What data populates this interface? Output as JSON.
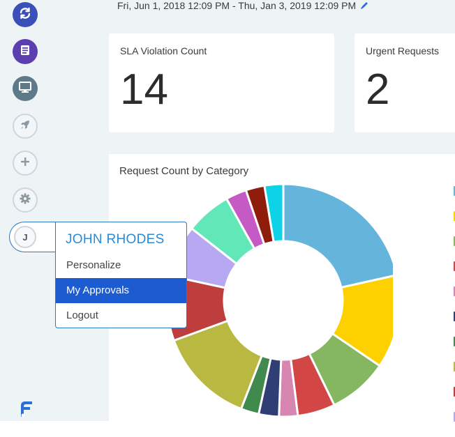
{
  "header": {
    "date_range": "Fri, Jun 1, 2018 12:09 PM - Thu, Jan 3, 2019 12:09 PM",
    "edit_icon": "pencil-icon"
  },
  "sidebar": {
    "items": [
      {
        "icon": "refresh-icon",
        "color": "#3b4fb8"
      },
      {
        "icon": "book-icon",
        "color": "#5b3fae"
      },
      {
        "icon": "monitor-icon",
        "color": "#5e7a89"
      },
      {
        "icon": "rocket-icon"
      },
      {
        "icon": "plus-icon"
      },
      {
        "icon": "gear-icon"
      }
    ],
    "logo_icon": "brand-logo-icon"
  },
  "cards": [
    {
      "label": "SLA Violation Count",
      "value": "14"
    },
    {
      "label": "Urgent Requests",
      "value": "2"
    }
  ],
  "chart_card": {
    "title": "Request Count by Category"
  },
  "chart_data": {
    "type": "pie",
    "title": "Request Count by Category",
    "values": [
      21.5,
      13.0,
      8.3,
      5.2,
      2.6,
      2.8,
      2.5,
      13.5,
      9.0,
      7.2,
      6.3,
      2.9,
      2.6,
      2.6
    ],
    "colors": [
      "#64b4dc",
      "#fdd100",
      "#84b760",
      "#d24746",
      "#d686b0",
      "#2f3f76",
      "#3f8a4c",
      "#b9b840",
      "#be3d3d",
      "#b7a8f2",
      "#62e8b8",
      "#c55ac4",
      "#8e1d0c",
      "#0ed3e7"
    ],
    "legend_colors": [
      "#64b4dc",
      "#fdd100",
      "#84b760",
      "#d24746",
      "#d686b0",
      "#2f3f76",
      "#3f8a4c",
      "#b9b840",
      "#be3d3d",
      "#b7a8f2"
    ],
    "legend": "right"
  },
  "user_menu": {
    "avatar_initial": "J",
    "name": "JOHN RHODES",
    "items": [
      "Personalize",
      "My Approvals",
      "Logout"
    ],
    "active_index": 1
  },
  "colors": {
    "accent": "#2a78c7",
    "active": "#1d5bd1",
    "name": "#2a8ad6",
    "background": "#eef3f6"
  }
}
